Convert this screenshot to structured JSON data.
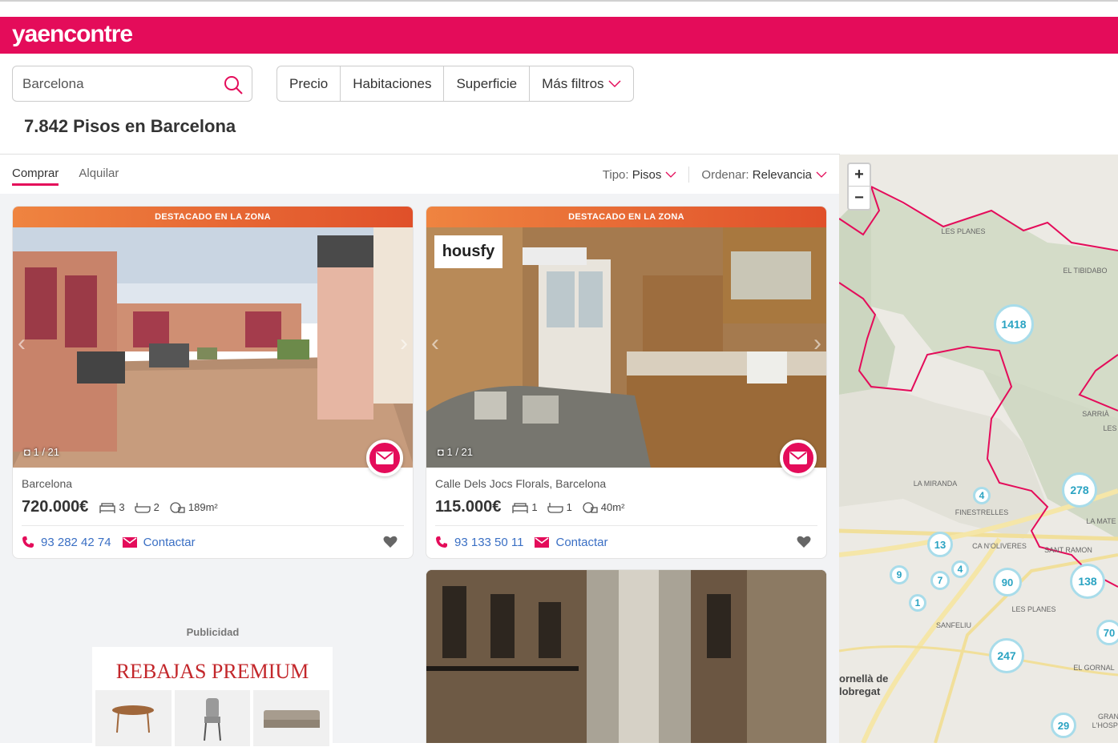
{
  "brand": {
    "name": "yaencontre",
    "accent": "#e40c5a"
  },
  "search": {
    "value": "Barcelona"
  },
  "filters": [
    "Precio",
    "Habitaciones",
    "Superficie",
    "Más filtros"
  ],
  "results_title": "7.842 Pisos en Barcelona",
  "tabs": {
    "buy": "Comprar",
    "rent": "Alquilar"
  },
  "sort": {
    "type_label": "Tipo:",
    "type_value": "Pisos",
    "order_label": "Ordenar:",
    "order_value": "Relevancia"
  },
  "listings": [
    {
      "banner": "DESTACADO EN LA ZONA",
      "photo_count": "1 / 21",
      "location": "Barcelona",
      "price": "720.000€",
      "rooms": "3",
      "baths": "2",
      "area": "189m²",
      "phone": "93 282 42 74",
      "contact": "Contactar"
    },
    {
      "banner": "DESTACADO EN LA ZONA",
      "photo_count": "1 / 21",
      "agency_logo": "housfy",
      "location": "Calle Dels Jocs Florals, Barcelona",
      "price": "115.000€",
      "rooms": "1",
      "baths": "1",
      "area": "40m²",
      "phone": "93 133 50 11",
      "contact": "Contactar"
    }
  ],
  "ad": {
    "label": "Publicidad",
    "title": "REBAJAS PREMIUM"
  },
  "map": {
    "zoom_in": "+",
    "zoom_out": "−",
    "clusters": [
      "1418",
      "278",
      "13",
      "4",
      "9",
      "7",
      "4",
      "90",
      "138",
      "1",
      "247",
      "70",
      "29"
    ],
    "labels": [
      "LES PLANES",
      "EL TIBIDABO",
      "SARRIÀ",
      "LES",
      "LA MIRANDA",
      "FINESTRELLES",
      "LA MATE",
      "CA N'OLIVERES",
      "SANT RAMON",
      "LES PLANES",
      "SANFELIU",
      "EL GORNAL",
      "GRAN",
      "L'HOSPI",
      "ornellà de",
      "lobregat"
    ]
  }
}
